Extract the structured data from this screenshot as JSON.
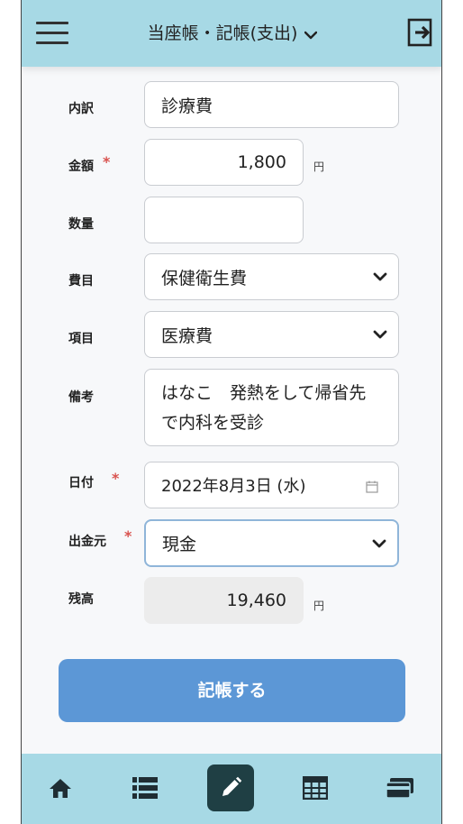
{
  "header": {
    "title": "当座帳・記帳(支出)"
  },
  "form": {
    "breakdown": {
      "label": "内訳",
      "value": "診療費"
    },
    "amount": {
      "label": "金額",
      "value": "1,800",
      "unit": "円",
      "required_mark": "*"
    },
    "quantity": {
      "label": "数量",
      "value": ""
    },
    "expense_item": {
      "label": "費目",
      "value": "保健衛生費"
    },
    "sub_item": {
      "label": "項目",
      "value": "医療費"
    },
    "memo": {
      "label": "備考",
      "value": "はなこ　発熱をして帰省先\nで内科を受診"
    },
    "date": {
      "label": "日付",
      "value": "2022年8月3日 (水)",
      "required_mark": "*"
    },
    "source": {
      "label": "出金元",
      "value": "現金",
      "required_mark": "*"
    },
    "balance": {
      "label": "残高",
      "value": "19,460",
      "unit": "円"
    }
  },
  "submit_label": "記帳する",
  "colors": {
    "header_bg": "#a7d9e5",
    "submit_bg": "#5c97d6",
    "required": "#d9534f",
    "active_nav": "#1f3f44"
  },
  "bottom_nav": [
    "home-icon",
    "list-icon",
    "pencil-icon",
    "calendar-grid-icon",
    "wallet-icon"
  ]
}
